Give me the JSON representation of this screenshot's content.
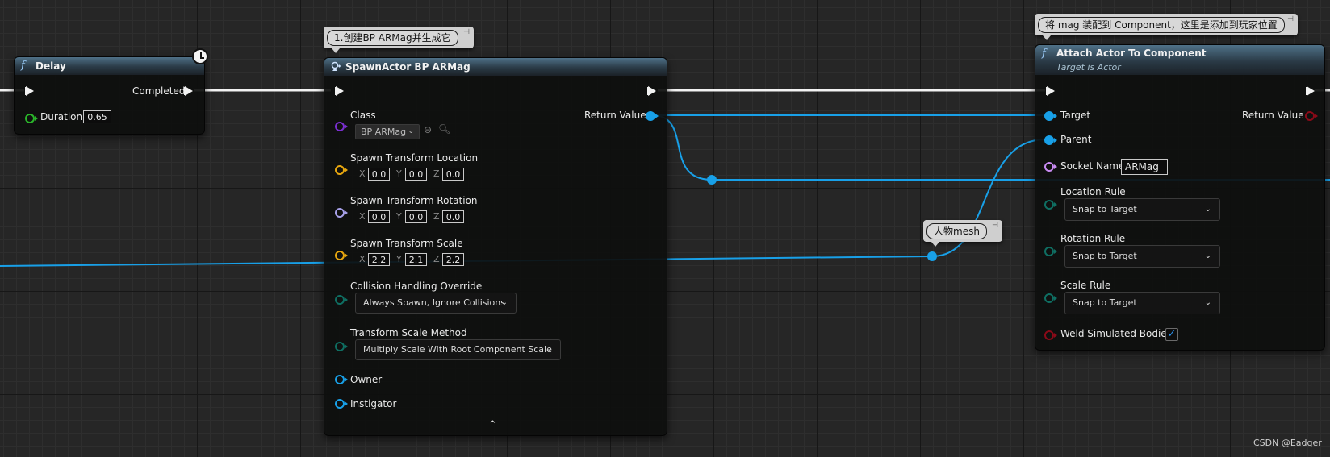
{
  "colors": {
    "exec": "#f2f2f2",
    "object": "#18a0e8",
    "class": "#7a2fd0",
    "vector": "#e8a70f",
    "rotator": "#a7a0e8",
    "enum": "#0f6e62",
    "float": "#2ab62a",
    "name": "#c88af2",
    "bool": "#8a0a18"
  },
  "delay_node": {
    "title": "Delay",
    "icon": "function-icon",
    "completed_label": "Completed",
    "duration_label": "Duration",
    "duration_value": "0.65"
  },
  "spawn_node": {
    "comment": "1.创建BP ARMag并生成它",
    "title": "SpawnActor BP ARMag",
    "icon": "spawn-icon",
    "class_label": "Class",
    "class_value": "BP ARMag",
    "return_label": "Return Value",
    "location_label": "Spawn Transform Location",
    "location": {
      "x": "0.0",
      "y": "0.0",
      "z": "0.0"
    },
    "rotation_label": "Spawn Transform Rotation",
    "rotation": {
      "x": "0.0",
      "y": "0.0",
      "z": "0.0"
    },
    "scale_label": "Spawn Transform Scale",
    "scale": {
      "x": "2.2",
      "y": "2.1",
      "z": "2.2"
    },
    "axis": {
      "x": "X",
      "y": "Y",
      "z": "Z"
    },
    "collision_label": "Collision Handling Override",
    "collision_value": "Always Spawn, Ignore Collisions",
    "scale_method_label": "Transform Scale Method",
    "scale_method_value": "Multiply Scale With Root Component Scale",
    "owner_label": "Owner",
    "instigator_label": "Instigator"
  },
  "reroute_comment": "人物mesh",
  "attach_node": {
    "comment": "将 mag 装配到 Component，这里是添加到玩家位置",
    "title": "Attach Actor To Component",
    "subtitle": "Target is Actor",
    "target_label": "Target",
    "return_label": "Return Value",
    "parent_label": "Parent",
    "socket_label": "Socket Name",
    "socket_value": "ARMag",
    "location_rule_label": "Location Rule",
    "location_rule_value": "Snap to Target",
    "rotation_rule_label": "Rotation Rule",
    "rotation_rule_value": "Snap to Target",
    "scale_rule_label": "Scale Rule",
    "scale_rule_value": "Snap to Target",
    "weld_label": "Weld Simulated Bodies",
    "weld_checked": true
  },
  "watermark": "CSDN @Eadger"
}
